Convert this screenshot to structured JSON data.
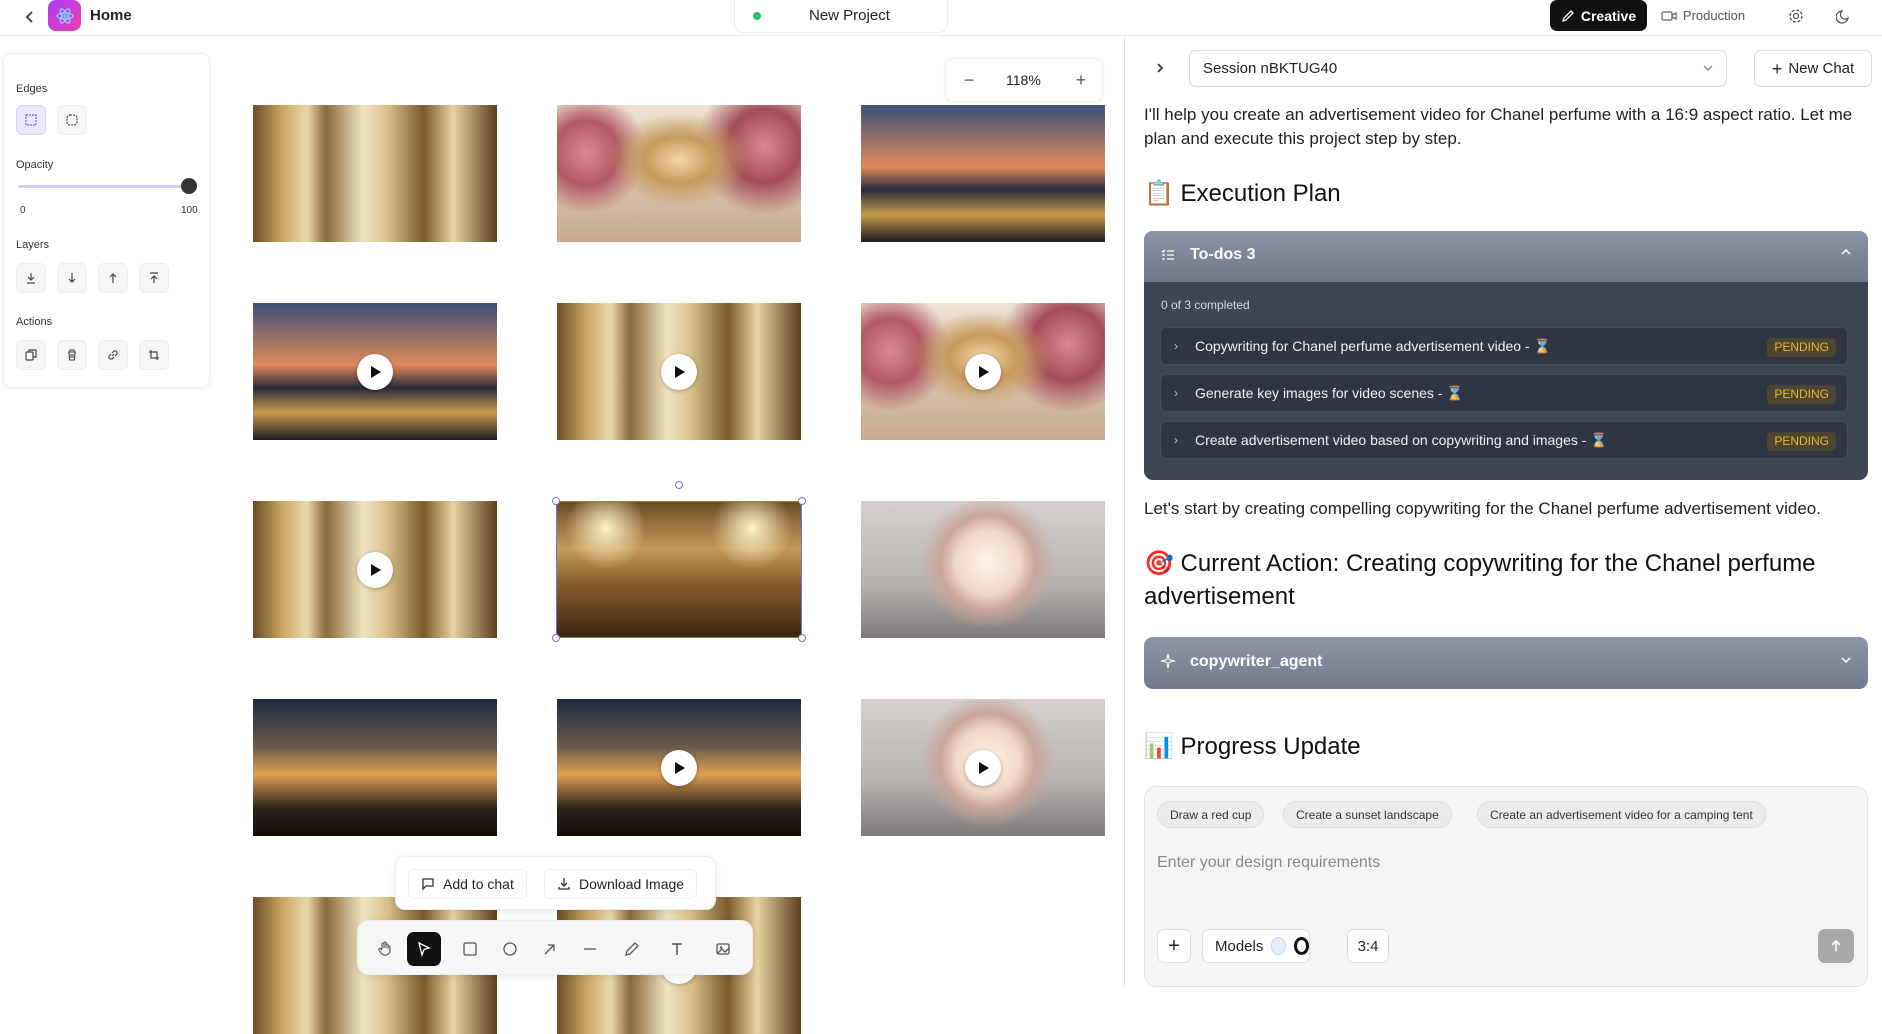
{
  "topbar": {
    "home_label": "Home",
    "project_name": "New Project",
    "mode_creative": "Creative",
    "mode_production": "Production"
  },
  "left_panel": {
    "edges_label": "Edges",
    "opacity_label": "Opacity",
    "opacity_min": "0",
    "opacity_max": "100",
    "opacity_value": 100,
    "layers_label": "Layers",
    "actions_label": "Actions"
  },
  "canvas": {
    "zoom": "118%",
    "images": [
      {
        "scene": "palace-hall",
        "video": false
      },
      {
        "scene": "perfume-roses",
        "video": false
      },
      {
        "scene": "eiffel-balcony",
        "video": false
      },
      {
        "scene": "eiffel-balcony",
        "video": true
      },
      {
        "scene": "palace-hall",
        "video": true
      },
      {
        "scene": "perfume-roses",
        "video": true
      },
      {
        "scene": "palace-hall",
        "video": true
      },
      {
        "scene": "ballroom-woman",
        "video": false,
        "selected": true
      },
      {
        "scene": "perfume-glow",
        "video": false
      },
      {
        "scene": "eiffel-night",
        "video": false
      },
      {
        "scene": "eiffel-night",
        "video": true
      },
      {
        "scene": "perfume-glow",
        "video": true
      },
      {
        "scene": "palace-hall",
        "video": false
      },
      {
        "scene": "palace-hall",
        "video": true
      }
    ],
    "add_to_chat": "Add to chat",
    "download_image": "Download Image"
  },
  "chat": {
    "session": "Session nBKTUG40",
    "new_chat": "New Chat",
    "intro": "I'll help you create an advertisement video for Chanel perfume with a 16:9 aspect ratio. Let me plan and execute this project step by step.",
    "plan_heading": "📋 Execution Plan",
    "todos_title": "To-dos 3",
    "todos_count": "0 of 3 completed",
    "todos": [
      {
        "text": "Copywriting for Chanel perfume advertisement video - ⌛",
        "status": "PENDING"
      },
      {
        "text": "Generate key images for video scenes - ⌛",
        "status": "PENDING"
      },
      {
        "text": "Create advertisement video based on copywriting and images - ⌛",
        "status": "PENDING"
      }
    ],
    "start_text": "Let's start by creating compelling copywriting for the Chanel perfume advertisement video.",
    "action_heading": "🎯 Current Action: Creating copywriting for the Chanel perfume advertisement",
    "agent_name": "copywriter_agent",
    "progress_heading": "📊 Progress Update",
    "suggestions": [
      "Draw a red cup",
      "Create a sunset landscape",
      "Create an advertisement video for a camping tent"
    ],
    "input_placeholder": "Enter your design requirements",
    "models_label": "Models",
    "ratio": "3:4"
  }
}
